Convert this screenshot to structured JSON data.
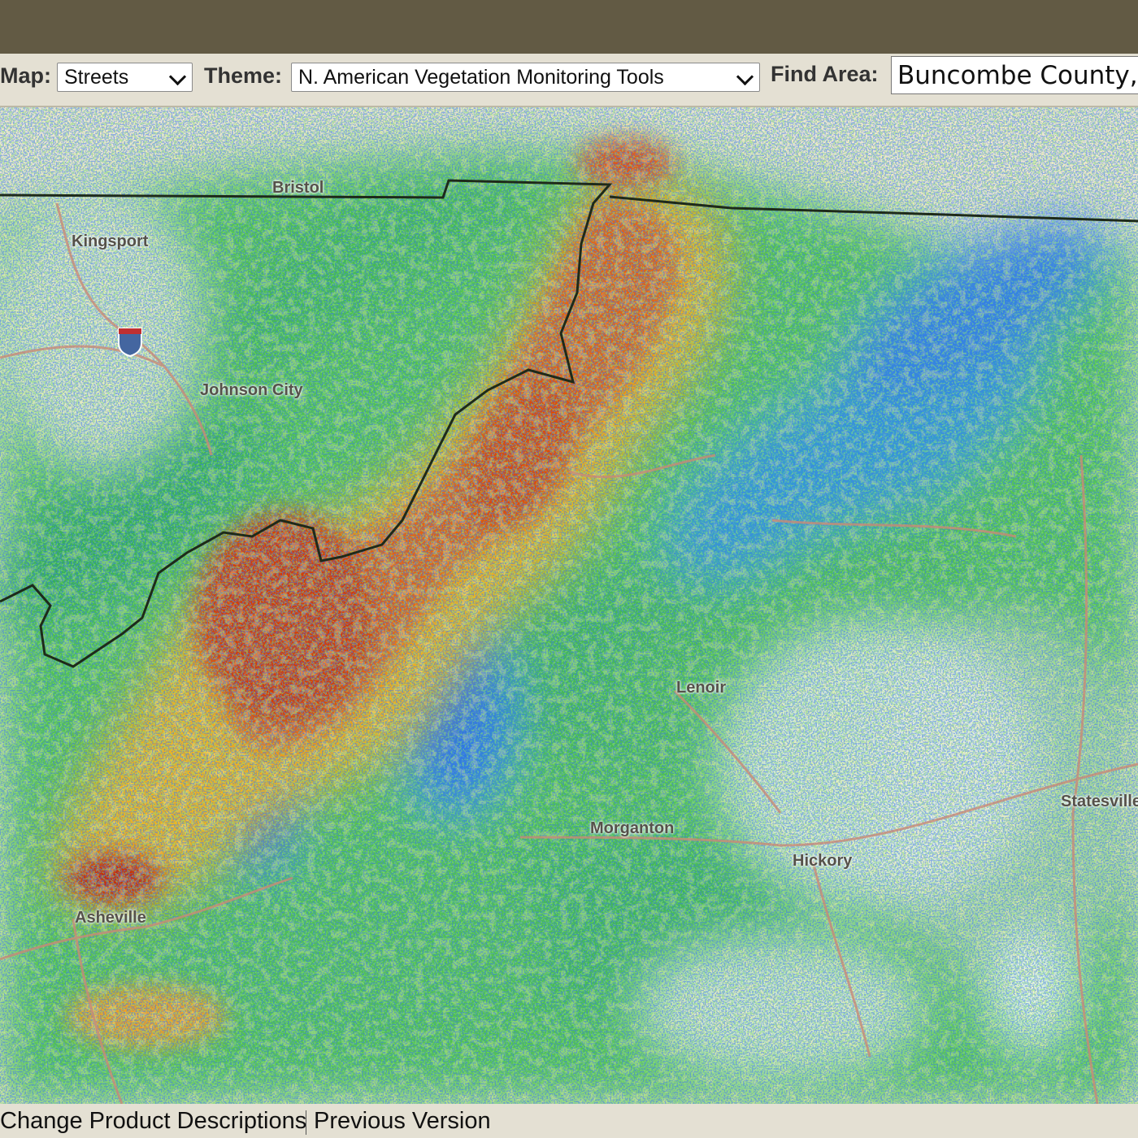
{
  "toolbar": {
    "map_label": "Map:",
    "map_value": "Streets",
    "theme_label": "Theme:",
    "theme_value": "N. American Vegetation Monitoring Tools",
    "find_label": "Find Area:",
    "find_value": "Buncombe County,"
  },
  "map": {
    "places": [
      "Bristol",
      "Kingsport",
      "Johnson City",
      "Lenoir",
      "Morganton",
      "Hickory",
      "Asheville",
      "Statesville"
    ]
  },
  "footer": {
    "link1": "Change Product Descriptions",
    "link2": "Previous Version"
  },
  "colors": {
    "topbar": "#625a44",
    "toolbar": "#e4e0d3",
    "high_change": "#d92a00",
    "medium_change": "#f5a300",
    "low_change": "#e6e000",
    "gain_light": "#3fc23f",
    "gain_strong": "#1050e0",
    "basemap": "#ece6d3",
    "state_boundary": "#1e2a1a"
  }
}
